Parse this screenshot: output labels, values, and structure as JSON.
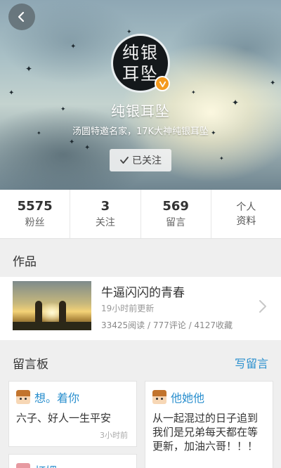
{
  "header": {
    "back_icon": "back-arrow-icon",
    "avatar_text": "纯银耳坠",
    "verified_icon": "verified-v-icon",
    "name": "纯银耳坠",
    "bio": "汤圆特邀名家，17K大神纯银耳坠",
    "follow_label": "已关注",
    "follow_icon": "check-icon"
  },
  "stats": [
    {
      "value": "5575",
      "label": "粉丝"
    },
    {
      "value": "3",
      "label": "关注"
    },
    {
      "value": "569",
      "label": "留言"
    }
  ],
  "profile_link": {
    "line1": "个人",
    "line2": "资料"
  },
  "works": {
    "section_title": "作品",
    "items": [
      {
        "title": "牛逼闪闪的青春",
        "updated": "19小时前更新",
        "stats": "33425阅读 / 777评论 / 4127收藏"
      }
    ]
  },
  "board": {
    "section_title": "留言板",
    "write_label": "写留言",
    "messages": [
      {
        "user": "想。着你",
        "text": "六子、好人一生平安",
        "time": "3小时前"
      },
      {
        "user": "他她他",
        "text": "从一起混过的日子追到我们是兄弟每天都在等更新，加油六哥！！！"
      },
      {
        "user": "灯娌",
        "text": ""
      }
    ]
  },
  "colors": {
    "accent_blue": "#2a8fce",
    "verified_orange": "#f39a1f"
  }
}
